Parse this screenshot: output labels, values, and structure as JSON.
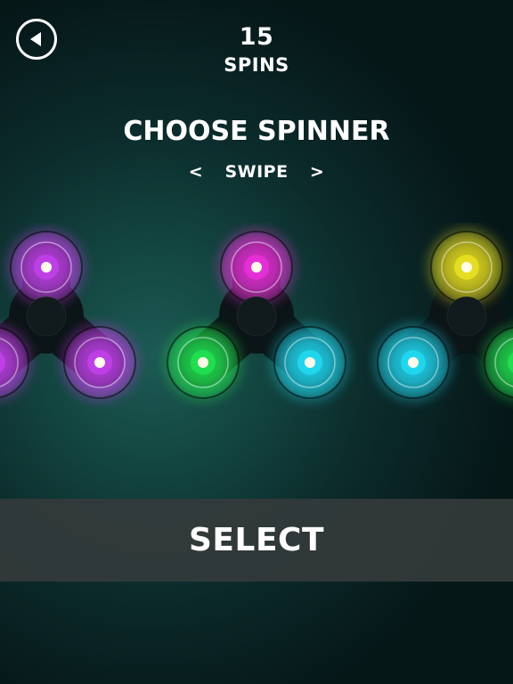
{
  "header": {
    "spins_count": "15",
    "spins_label": "SPINS"
  },
  "screen": {
    "title": "CHOOSE SPINNER",
    "swipe_left": "<",
    "swipe_label": "SWIPE",
    "swipe_right": ">"
  },
  "icons": {
    "back": "back-arrow-icon"
  },
  "spinners": [
    {
      "name": "spinner-purple",
      "arms": [
        "#c040e8",
        "#c040e8",
        "#c040e8"
      ]
    },
    {
      "name": "spinner-pink-green-cyan",
      "arms": [
        "#e830d8",
        "#20e050",
        "#20d8f0"
      ]
    },
    {
      "name": "spinner-yellow-cyan-green",
      "arms": [
        "#e8e020",
        "#20d8f0",
        "#20e050"
      ]
    }
  ],
  "actions": {
    "select_label": "SELECT"
  }
}
